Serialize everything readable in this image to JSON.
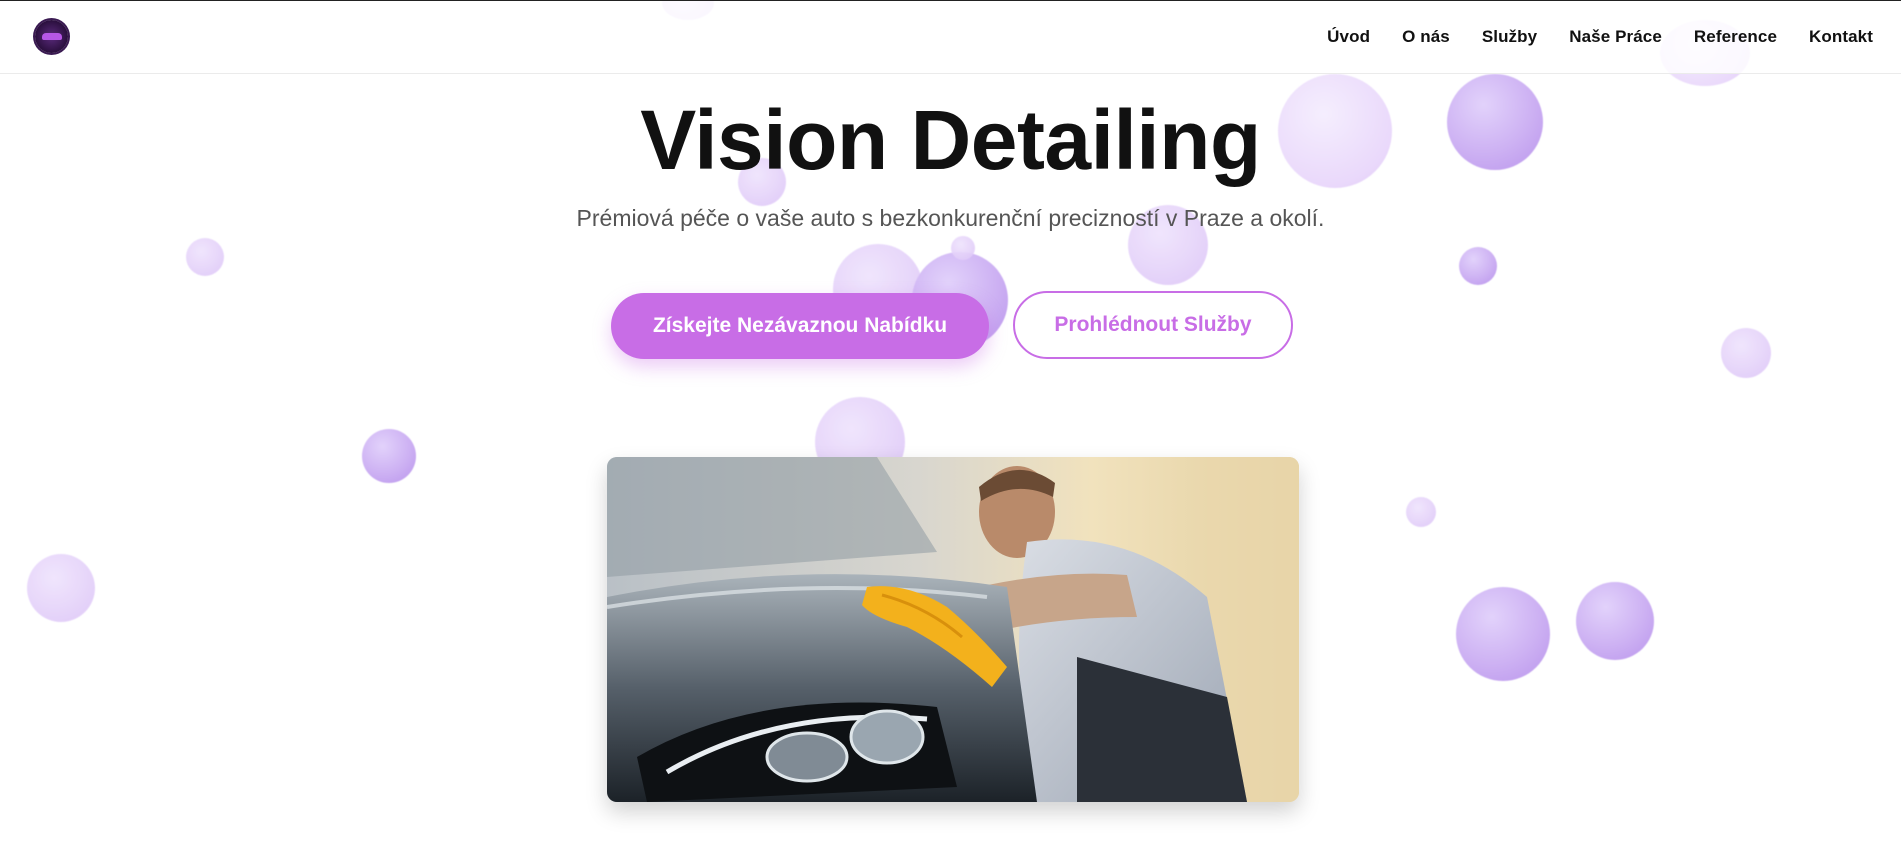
{
  "brand": {
    "logo_icon": "vision-detailing-logo-icon"
  },
  "nav": {
    "items": [
      {
        "label": "Úvod"
      },
      {
        "label": "O nás"
      },
      {
        "label": "Služby"
      },
      {
        "label": "Naše Práce"
      },
      {
        "label": "Reference"
      },
      {
        "label": "Kontakt"
      }
    ]
  },
  "hero": {
    "title": "Vision Detailing",
    "subtitle": "Prémiová péče o vaše auto s bezkonkurenční precizností v Praze a okolí.",
    "primary_button": "Získejte Nezávaznou Nabídku",
    "secondary_button": "Prohlédnout Služby",
    "image_icon": "car-detailing-photo-icon"
  },
  "colors": {
    "accent": "#c86de6",
    "bubble": "#cdb1f3",
    "text": "#111111",
    "subtitle": "#555555"
  }
}
